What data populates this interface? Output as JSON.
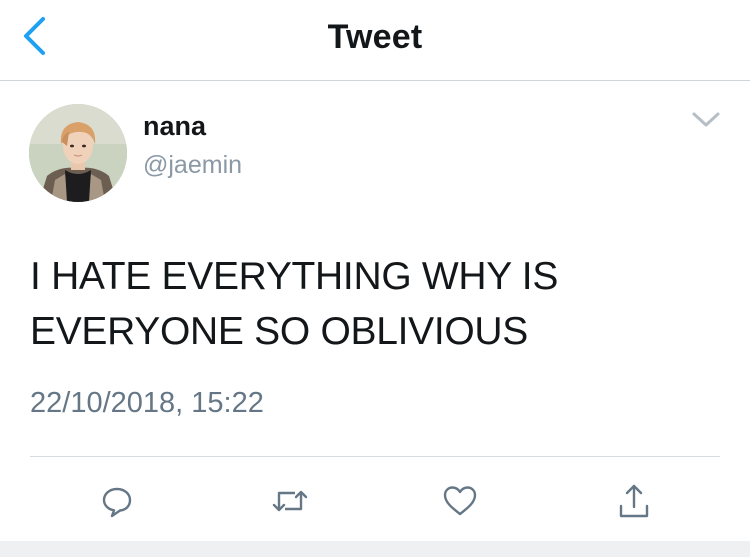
{
  "header": {
    "title": "Tweet",
    "back_icon": "chevron-left-icon",
    "accent_color": "#1da1f2"
  },
  "tweet": {
    "display_name": "nana",
    "handle": "@jaemin",
    "text": "I HATE EVERYTHING WHY IS EVERYONE SO OBLIVIOUS",
    "timestamp": "22/10/2018, 15:22"
  },
  "actions": [
    "reply-icon",
    "retweet-icon",
    "like-icon",
    "share-icon"
  ],
  "colors": {
    "text": "#14171a",
    "secondary": "#657786",
    "handle": "#8b98a5",
    "icon": "#657786"
  }
}
